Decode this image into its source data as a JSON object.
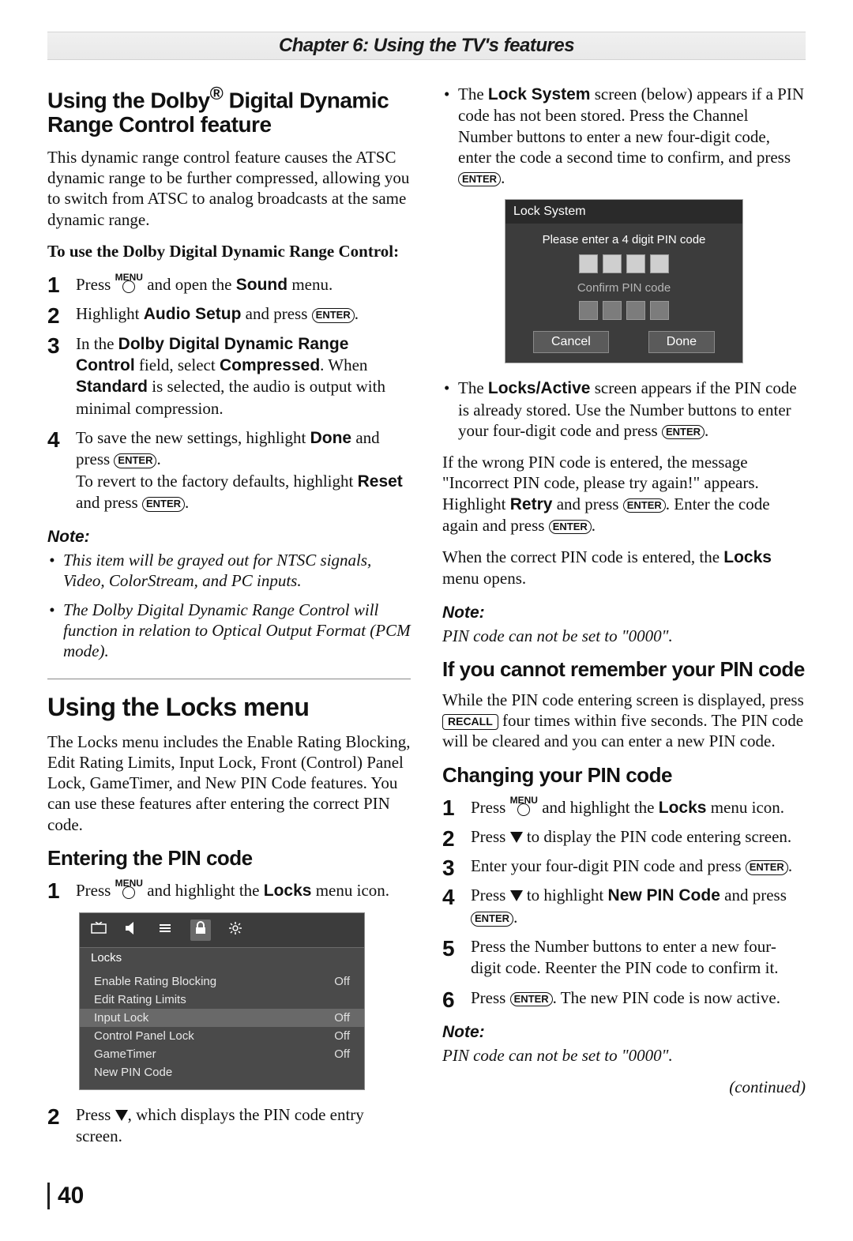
{
  "chapter_title": "Chapter 6: Using the TV's features",
  "left": {
    "h_dolby_1": "Using the Dolby",
    "h_dolby_reg": "®",
    "h_dolby_2": " Digital Dynamic Range Control feature",
    "dolby_intro": "This dynamic range control feature causes the ATSC dynamic range to be further compressed, allowing you to switch from ATSC to analog broadcasts at the same dynamic range.",
    "dolby_howto": "To use the Dolby Digital Dynamic Range Control:",
    "step1_a": "Press ",
    "step1_b": " and open the ",
    "step1_sound": "Sound",
    "step1_c": " menu.",
    "step2_a": "Highlight ",
    "step2_audio": "Audio Setup",
    "step2_b": " and press ",
    "step3_a": "In the ",
    "step3_field": "Dolby Digital Dynamic Range Control",
    "step3_b": " field, select ",
    "step3_comp": "Compressed",
    "step3_c": ". When ",
    "step3_std": "Standard",
    "step3_d": " is selected, the audio is output with minimal compression.",
    "step4_a": "To save the new settings, highlight ",
    "step4_done": "Done",
    "step4_b": " and press ",
    "step4_c": "To revert to the factory defaults, highlight ",
    "step4_reset": "Reset",
    "step4_d": " and press ",
    "note_label": "Note:",
    "note1": "This item will be grayed out for NTSC signals, Video, ColorStream, and PC inputs.",
    "note2": "The Dolby Digital Dynamic Range Control will function in relation to Optical Output Format (PCM mode).",
    "h_locks": "Using the Locks menu",
    "locks_intro": "The Locks menu includes the Enable Rating Blocking, Edit Rating Limits, Input Lock, Front (Control) Panel Lock, GameTimer, and New PIN Code features. You can use these features after entering the correct PIN code.",
    "h_enter_pin": "Entering the PIN code",
    "ep_step1_a": "Press ",
    "ep_step1_b": " and highlight the ",
    "ep_step1_locks": "Locks",
    "ep_step1_c": " menu icon.",
    "ep_step2_a": "Press ",
    "ep_step2_b": ", which displays the PIN code entry screen.",
    "osd": {
      "title": "Locks",
      "items": [
        {
          "label": "Enable Rating Blocking",
          "value": "Off"
        },
        {
          "label": "Edit Rating Limits",
          "value": ""
        },
        {
          "label": "Input Lock",
          "value": "Off"
        },
        {
          "label": "Control Panel Lock",
          "value": "Off"
        },
        {
          "label": "GameTimer",
          "value": "Off"
        },
        {
          "label": "New PIN Code",
          "value": ""
        }
      ]
    }
  },
  "right": {
    "bull1_a": "The ",
    "bull1_ls": "Lock System",
    "bull1_b": " screen (below) appears if a PIN code has not been stored. Press the Channel Number buttons to enter a new four-digit code, enter the code a second time to confirm, and press ",
    "dlg": {
      "title": "Lock System",
      "msg": "Please enter a 4 digit PIN code",
      "confirm": "Confirm PIN code",
      "cancel": "Cancel",
      "done": "Done"
    },
    "bull2_a": "The ",
    "bull2_la": "Locks/Active",
    "bull2_b": " screen appears if the PIN code is already stored. Use the Number buttons to enter your four-digit code and press ",
    "wrong1": "If the wrong PIN code is entered, the message \"Incorrect PIN code, please try again!\" appears. Highlight ",
    "wrong_retry": "Retry",
    "wrong2": " and press ",
    "wrong3": ". Enter the code again and press ",
    "correct_a": "When the correct PIN code is entered, the ",
    "correct_locks": "Locks",
    "correct_b": " menu opens.",
    "note_label": "Note:",
    "note_pin0": "PIN code can not be set to \"0000\".",
    "h_forget": "If you cannot remember your PIN code",
    "forget_a": "While the PIN code entering screen is displayed, press ",
    "forget_b": " four times within five seconds. The PIN code will be cleared and you can enter a new PIN code.",
    "h_change": "Changing your PIN code",
    "cs1_a": "Press ",
    "cs1_b": " and highlight the ",
    "cs1_locks": "Locks",
    "cs1_c": " menu icon.",
    "cs2_a": "Press ",
    "cs2_b": " to display the PIN code entering screen.",
    "cs3_a": "Enter your four-digit PIN code and press ",
    "cs4_a": "Press ",
    "cs4_b": " to highlight ",
    "cs4_npc": "New PIN Code",
    "cs4_c": " and press ",
    "cs5": "Press the Number buttons to enter a new four-digit code. Reenter the PIN code to confirm it.",
    "cs6_a": "Press ",
    "cs6_b": ". The new PIN code is now active.",
    "continued": "(continued)"
  },
  "btn": {
    "enter": "ENTER",
    "recall": "RECALL",
    "menu": "MENU"
  },
  "page_number": "40"
}
